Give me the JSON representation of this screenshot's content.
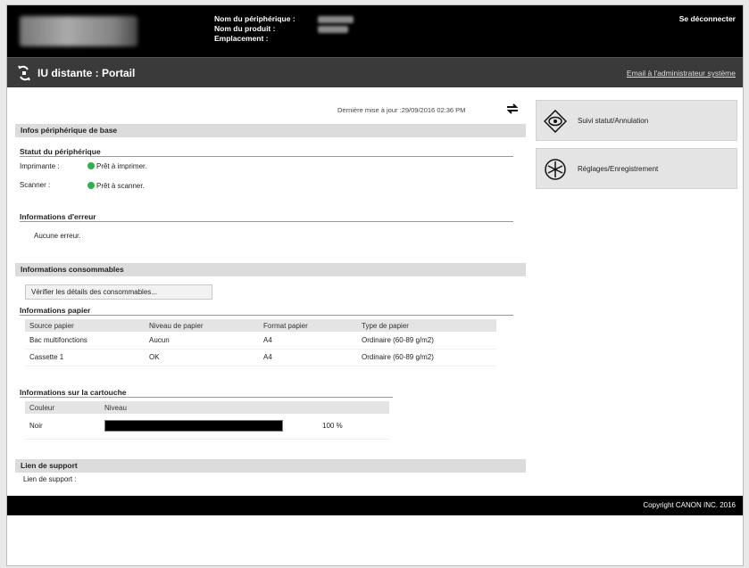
{
  "header": {
    "device_name_label": "Nom du périphérique :",
    "product_name_label": "Nom du produit :",
    "location_label": "Emplacement :",
    "logout": "Se déconnecter"
  },
  "titlebar": {
    "title": "IU distante : Portail",
    "admin_email": "Email à l'administrateur système"
  },
  "last_update": "Dernière mise à jour :29/09/2016 02:36 PM",
  "basic_info": {
    "heading": "Infos périphérique de base",
    "status_heading": "Statut du périphérique",
    "printer_label": "Imprimante :",
    "printer_status": "Prêt à imprimer.",
    "scanner_label": "Scanner :",
    "scanner_status": "Prêt à scanner.",
    "error_heading": "Informations d'erreur",
    "error_text": "Aucune erreur."
  },
  "consumables": {
    "heading": "Informations consommables",
    "check_button": "Vérifier les détails des consommables...",
    "paper_heading": "Informations papier",
    "paper_columns": [
      "Source papier",
      "Niveau de papier",
      "Format papier",
      "Type de papier"
    ],
    "paper_rows": [
      [
        "Bac multifonctions",
        "Aucun",
        "A4",
        "Ordinaire (60-89 g/m2)"
      ],
      [
        "Cassette 1",
        "OK",
        "A4",
        "Ordinaire (60-89 g/m2)"
      ]
    ],
    "cartridge_heading": "Informations sur la cartouche",
    "cartridge_columns": [
      "Couleur",
      "Niveau"
    ],
    "cartridge_rows": [
      {
        "color": "Noir",
        "level_text": "100 %",
        "level_fraction": 1.0
      }
    ]
  },
  "support": {
    "heading": "Lien de support",
    "link_label": "Lien de support :"
  },
  "sidebar": {
    "status_button": "Suivi statut/Annulation",
    "settings_button": "Réglages/Enregistrement"
  },
  "footer": {
    "copyright": "Copyright CANON INC. 2016"
  }
}
